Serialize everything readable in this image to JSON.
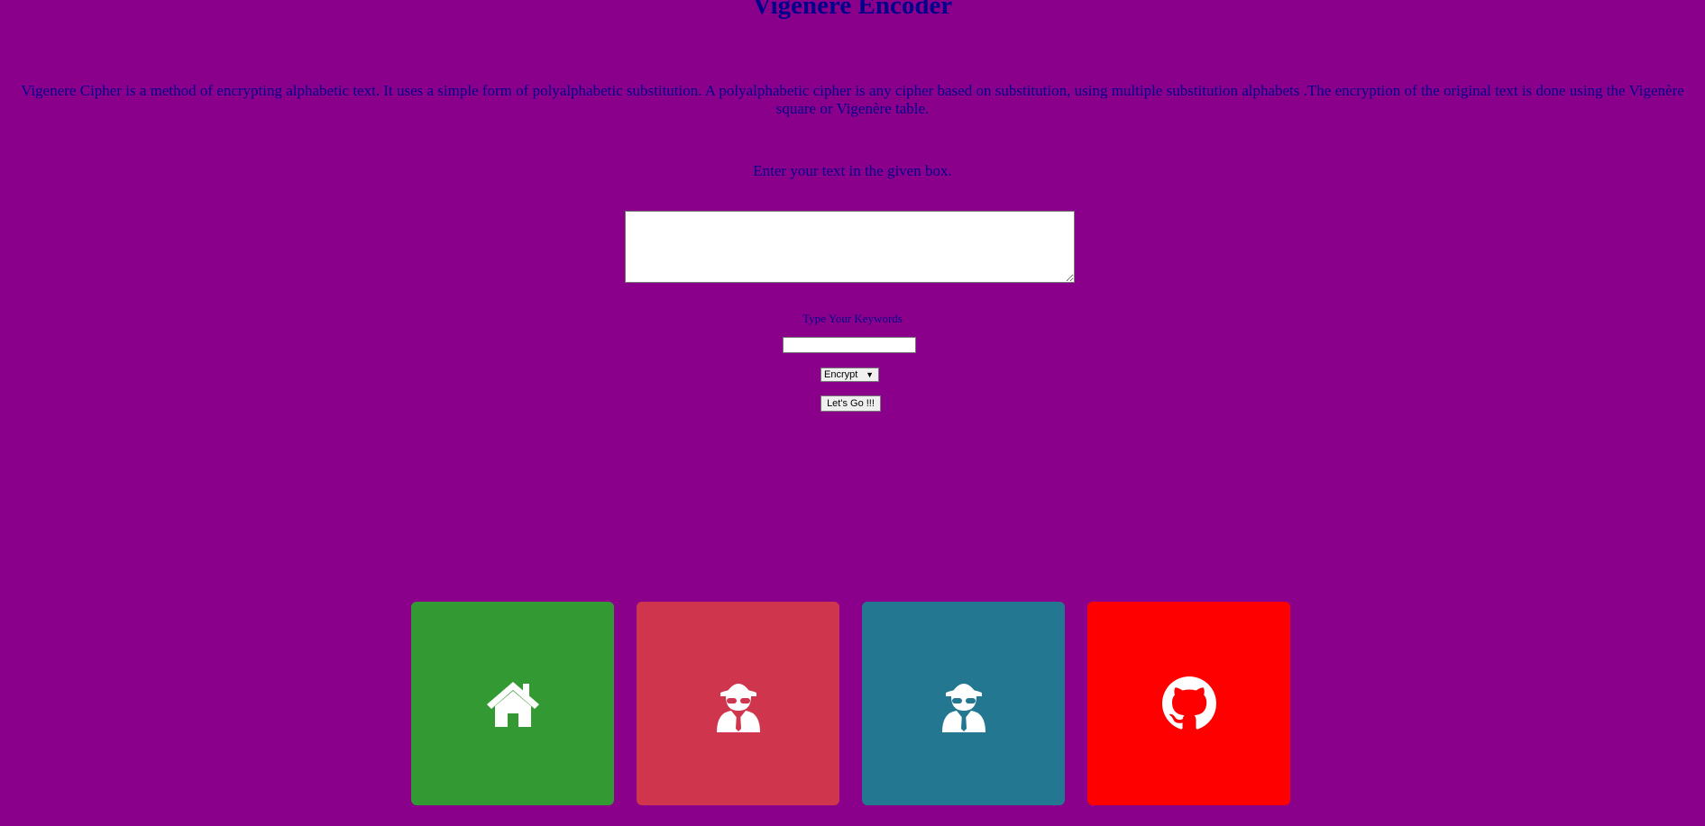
{
  "page": {
    "title": "Vigenere Encoder",
    "description": "Vigenere Cipher is a method of encrypting alphabetic text. It uses a simple form of polyalphabetic substitution. A polyalphabetic cipher is any cipher based on substitution, using multiple substitution alphabets .The encryption of the original text is done using the Vigenère square or Vigenère table.",
    "prompt": "Enter your text in the given box.",
    "keyword_label": "Type Your Keywords",
    "text_value": "",
    "keyword_value": ""
  },
  "controls": {
    "mode_selected": "Encrypt",
    "go_button_label": "Let's Go !!!"
  },
  "colors": {
    "background": "#8b008b",
    "text": "#00008b",
    "tile_home": "#339933",
    "tile_spy_1": "#cf364d",
    "tile_spy_2": "#247791",
    "tile_github": "#ff0000"
  },
  "tiles": [
    {
      "icon": "home-icon"
    },
    {
      "icon": "spy-icon"
    },
    {
      "icon": "spy-icon"
    },
    {
      "icon": "github-icon"
    }
  ]
}
